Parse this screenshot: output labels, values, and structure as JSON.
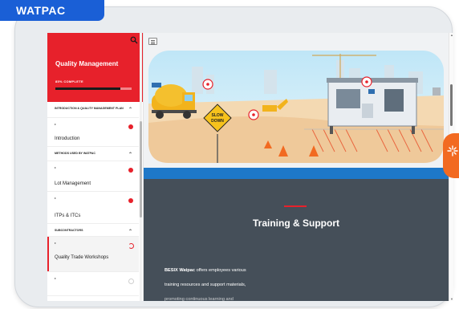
{
  "brand": {
    "label": "WATPAC",
    "color": "#1a5fd6"
  },
  "course": {
    "title": "Quality Management",
    "progress_label": "85% COMPLETE",
    "progress_fraction": 0.85,
    "accent_color": "#e7212b",
    "search_icon": "search-icon"
  },
  "sidebar": {
    "sections": [
      {
        "heading": "INTRODUCTION & QUALITY MANAGEMENT PLAN",
        "lessons": [
          {
            "label": "Introduction",
            "status": "in-progress"
          }
        ]
      },
      {
        "heading": "METHODS USED BY WATPAC",
        "lessons": [
          {
            "label": "Lot Management",
            "status": "in-progress"
          },
          {
            "label": "ITPs & ITCs",
            "status": "in-progress"
          }
        ]
      },
      {
        "heading": "SUBCONTRACTORS",
        "lessons": [
          {
            "label": "Quality Trade Workshops",
            "status": "current"
          },
          {
            "label": "",
            "status": "incomplete"
          }
        ]
      }
    ]
  },
  "main": {
    "hero": {
      "sign_line1": "SLOW",
      "sign_line2": "DOWN"
    },
    "band_color": "#1e78c8",
    "panel_color": "#454f59",
    "panel_title": "Training & Support",
    "panel_body_bold": "BESIX Watpac",
    "panel_body_line1": " offers employees various",
    "panel_body_line2": "training resources and support materials,",
    "panel_body_line3": "promoting continuous learning and"
  },
  "floating_badge": {
    "icon": "sparkle-icon",
    "color": "#f26a21"
  }
}
